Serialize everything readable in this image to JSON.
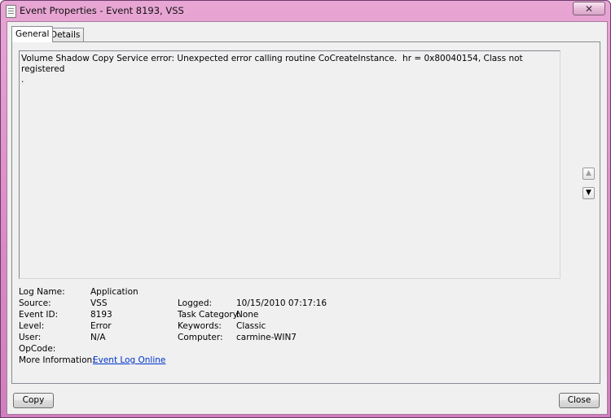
{
  "window": {
    "title": "Event Properties - Event 8193, VSS",
    "close_glyph": "✕"
  },
  "tabs": [
    {
      "label": "General"
    },
    {
      "label": "Details"
    }
  ],
  "description": "Volume Shadow Copy Service error: Unexpected error calling routine CoCreateInstance.  hr = 0x80040154, Class not registered\n.",
  "fields": {
    "log_name_label": "Log Name:",
    "log_name_value": "Application",
    "source_label": "Source:",
    "source_value": "VSS",
    "logged_label": "Logged:",
    "logged_value": "10/15/2010 07:17:16",
    "event_id_label": "Event ID:",
    "event_id_value": "8193",
    "task_category_label": "Task Category:",
    "task_category_value": "None",
    "level_label": "Level:",
    "level_value": "Error",
    "keywords_label": "Keywords:",
    "keywords_value": "Classic",
    "user_label": "User:",
    "user_value": "N/A",
    "computer_label": "Computer:",
    "computer_value": "carmine-WIN7",
    "opcode_label": "OpCode:",
    "opcode_value": "",
    "more_info_label": "More Information:",
    "more_info_link": "Event Log Online"
  },
  "nav": {
    "up_icon": "arrow-up-icon",
    "down_icon": "arrow-down-icon"
  },
  "buttons": {
    "copy": "Copy",
    "close": "Close"
  }
}
